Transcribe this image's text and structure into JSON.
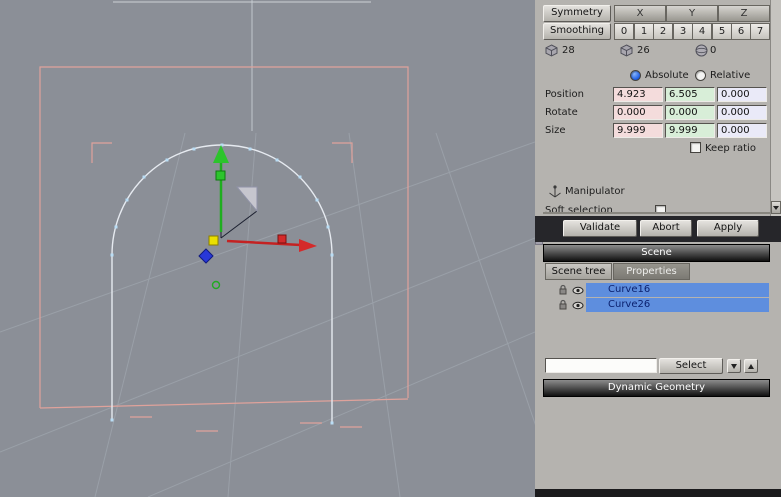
{
  "properties": {
    "symmetry_label": "Symmetry",
    "axis_columns": [
      "X",
      "Y",
      "Z"
    ],
    "smoothing_label": "Smoothing",
    "smoothing_levels": [
      "0",
      "1",
      "2",
      "3",
      "4",
      "5",
      "6",
      "7"
    ],
    "selection_counts": {
      "vertices": "28",
      "edges": "26",
      "faces": "0"
    },
    "coordinate_mode": {
      "absolute_label": "Absolute",
      "relative_label": "Relative",
      "selected": "Absolute"
    },
    "transform_rows": [
      {
        "label": "Position",
        "x": "4.923",
        "y": "6.505",
        "z": "0.000"
      },
      {
        "label": "Rotate",
        "x": "0.000",
        "y": "0.000",
        "z": "0.000"
      },
      {
        "label": "Size",
        "x": "9.999",
        "y": "9.999",
        "z": "0.000"
      }
    ],
    "keep_ratio_label": "Keep ratio",
    "manipulator_label": "Manipulator",
    "soft_selection_label": "Soft selection",
    "actions": {
      "validate": "Validate",
      "abort": "Abort",
      "apply": "Apply"
    }
  },
  "scene_panel": {
    "title": "Scene",
    "tabs": [
      {
        "label": "Scene tree",
        "active": true
      },
      {
        "label": "Properties",
        "active": false
      }
    ],
    "items": [
      {
        "name": "Curve16",
        "selected": true
      },
      {
        "name": "Curve26",
        "selected": true
      }
    ],
    "filter": {
      "value": "",
      "select_label": "Select"
    }
  },
  "dynamic_geometry_panel": {
    "title": "Dynamic Geometry"
  },
  "colors": {
    "selection_highlight": "#5e8ede",
    "field_x": "#f4dcdc",
    "field_y": "#d8eed8",
    "field_z": "#eaeaf8",
    "gizmo_y_axis": "#2cc42c",
    "gizmo_x_axis": "#d42a2a",
    "bounds_outline": "#dfa29b"
  }
}
